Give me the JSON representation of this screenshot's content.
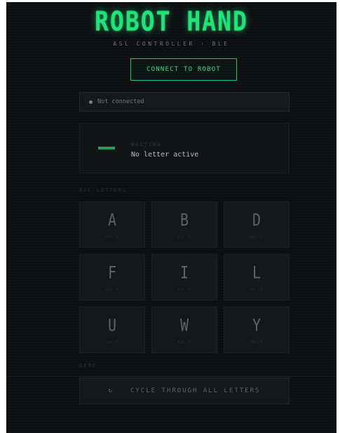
{
  "header": {
    "title": "ROBOT HAND",
    "subtitle": "ASL CONTROLLER · BLE"
  },
  "connect_button": {
    "label": "CONNECT TO ROBOT"
  },
  "status": {
    "text": "Not connected"
  },
  "active_panel": {
    "label": "WAITING",
    "value": "No letter active"
  },
  "letters_section": {
    "label": "ASL LETTERS",
    "letters": [
      {
        "glyph": "A",
        "caption": "VAL 0"
      },
      {
        "glyph": "B",
        "caption": "VAL 1"
      },
      {
        "glyph": "D",
        "caption": "VAL 2"
      },
      {
        "glyph": "F",
        "caption": "VAL 3"
      },
      {
        "glyph": "I",
        "caption": "VAL 4"
      },
      {
        "glyph": "L",
        "caption": "VAL 5"
      },
      {
        "glyph": "U",
        "caption": "VAL 6"
      },
      {
        "glyph": "W",
        "caption": "VAL 7"
      },
      {
        "glyph": "Y",
        "caption": "VAL 8"
      }
    ]
  },
  "demo_section": {
    "label": "DEMO",
    "cycle_icon": "↻",
    "cycle_label": "CYCLE THROUGH ALL LETTERS"
  },
  "colors": {
    "accent": "#22e37a",
    "background": "#0d1012",
    "card": "#15181a"
  }
}
